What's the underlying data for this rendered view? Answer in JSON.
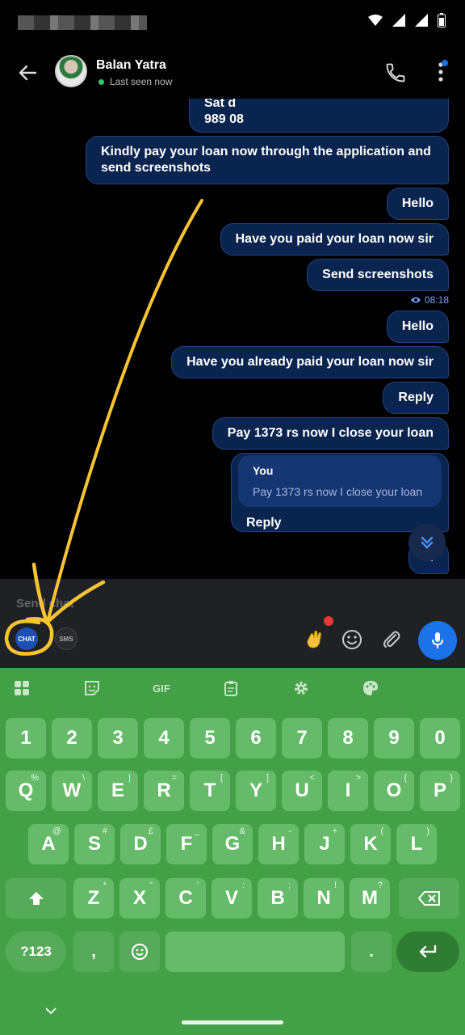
{
  "header": {
    "contact_name": "Balan Yatra",
    "status": "Last seen now"
  },
  "messages": {
    "partial_top_line1": "Sat       d",
    "partial_top_line2": "989        08",
    "m1_line1": "Kindly pay your loan now through the application and",
    "m1_line2": "send screenshots",
    "m2": "Hello",
    "m3": "Have you paid your loan now sir",
    "m4": "Send screenshots",
    "time1": "08:18",
    "m5": "Hello",
    "m6": "Have you already paid your loan now sir",
    "m7": "Reply",
    "m8": "Pay 1373 rs now I close your loan",
    "quote_name": "You",
    "quote_text": "Pay 1373 rs now I close your loan",
    "m9": "Reply",
    "m10_partial": "H"
  },
  "composer": {
    "placeholder": "Send chat",
    "mode_chat": "CHAT",
    "mode_sms": "SMS"
  },
  "keyboard": {
    "toolbar_gif": "GIF",
    "numbers": [
      "1",
      "2",
      "3",
      "4",
      "5",
      "6",
      "7",
      "8",
      "9",
      "0"
    ],
    "row1": [
      {
        "k": "Q",
        "a": "%"
      },
      {
        "k": "W",
        "a": "\\"
      },
      {
        "k": "E",
        "a": "|"
      },
      {
        "k": "R",
        "a": "="
      },
      {
        "k": "T",
        "a": "["
      },
      {
        "k": "Y",
        "a": "]"
      },
      {
        "k": "U",
        "a": "<"
      },
      {
        "k": "I",
        "a": ">"
      },
      {
        "k": "O",
        "a": "{"
      },
      {
        "k": "P",
        "a": "}"
      }
    ],
    "row2": [
      {
        "k": "A",
        "a": "@"
      },
      {
        "k": "S",
        "a": "#"
      },
      {
        "k": "D",
        "a": "£"
      },
      {
        "k": "F",
        "a": "_"
      },
      {
        "k": "G",
        "a": "&"
      },
      {
        "k": "H",
        "a": "-"
      },
      {
        "k": "J",
        "a": "+"
      },
      {
        "k": "K",
        "a": "("
      },
      {
        "k": "L",
        "a": ")"
      }
    ],
    "row3": [
      {
        "k": "Z",
        "a": "*"
      },
      {
        "k": "X",
        "a": "\""
      },
      {
        "k": "C",
        "a": "'"
      },
      {
        "k": "V",
        "a": ":"
      },
      {
        "k": "B",
        "a": ";"
      },
      {
        "k": "N",
        "a": "!"
      },
      {
        "k": "M",
        "a": "?"
      }
    ],
    "symbols_key": "?123",
    "comma_key": ",",
    "period_key": "."
  },
  "colors": {
    "bubble": "#0a2450",
    "accent": "#1a73e8",
    "keyboard": "#43a047",
    "annotation": "#f7c431"
  }
}
